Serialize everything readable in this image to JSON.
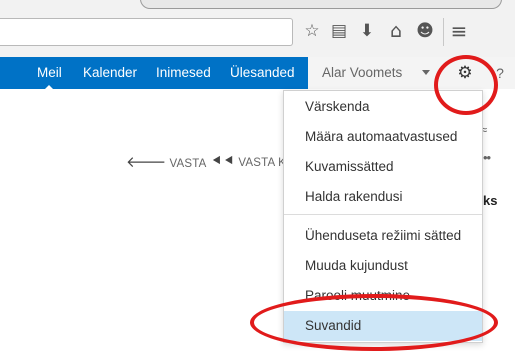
{
  "browser": {
    "icons": [
      "star-icon",
      "reading-list-icon",
      "download-icon",
      "home-icon",
      "chat-icon",
      "menu-icon"
    ],
    "glyphs": {
      "star": "☆",
      "reading": "▤",
      "download": "⬇",
      "home": "⌂",
      "chat": "☻",
      "menu": "≡"
    }
  },
  "nav": {
    "items": [
      "Meil",
      "Kalender",
      "Inimesed",
      "Ülesanded"
    ],
    "active": "Meil",
    "color": "#0072c6"
  },
  "user": {
    "name": "Alar Voomets",
    "gear_glyph": "⚙",
    "help_glyph": "?"
  },
  "reading_pane": {
    "reply": "VASTA",
    "reply_all": "VASTA K",
    "fragment_expand": "≈",
    "fragment_more": "••",
    "fragment_text": "ks"
  },
  "menu": {
    "items": [
      "Värskenda",
      "Määra automaatvastused",
      "Kuvamissätted",
      "Halda rakendusi",
      "Ühenduseta režiimi sätted",
      "Muuda kujundust",
      "Parooli muutmine",
      "Suvandid"
    ],
    "selected": "Suvandid",
    "highlight_color": "#cde6f7"
  },
  "annotation_color": "#e11b1b"
}
